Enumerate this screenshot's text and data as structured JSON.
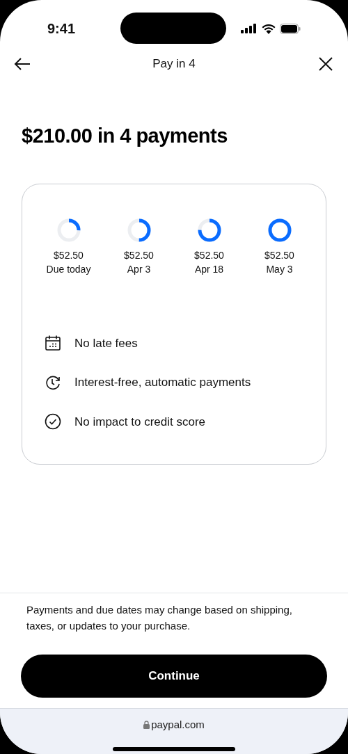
{
  "status_bar": {
    "time": "9:41"
  },
  "nav": {
    "title": "Pay in 4"
  },
  "heading": "$210.00 in 4 payments",
  "payments": [
    {
      "amount": "$52.50",
      "date": "Due today"
    },
    {
      "amount": "$52.50",
      "date": "Apr 3"
    },
    {
      "amount": "$52.50",
      "date": "Apr 18"
    },
    {
      "amount": "$52.50",
      "date": "May 3"
    }
  ],
  "features": [
    {
      "kind": "calendar",
      "text": "No late fees"
    },
    {
      "kind": "clock",
      "text": "Interest-free, automatic payments"
    },
    {
      "kind": "check",
      "text": "No impact to credit score"
    }
  ],
  "disclaimer": "Payments and due dates may change based on shipping, taxes, or updates to your purchase.",
  "button": "Continue",
  "url_bar": {
    "url": "paypal.com"
  }
}
